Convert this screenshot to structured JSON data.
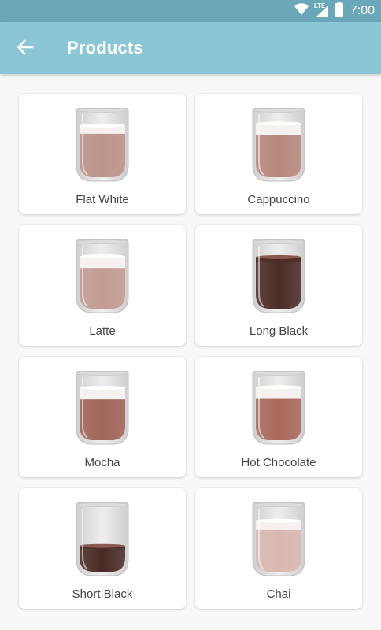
{
  "status_bar": {
    "time": "7:00",
    "network": "LTE",
    "icons": [
      "wifi-icon",
      "cell-signal-icon",
      "battery-icon"
    ]
  },
  "app_bar": {
    "title": "Products",
    "back_icon": "arrow-back-icon"
  },
  "colors": {
    "status_bar": "#6aa8b9",
    "app_bar": "#8bc6d6",
    "background": "#f8f8f8",
    "card": "#ffffff"
  },
  "products": [
    {
      "name": "Flat White",
      "fill": 0.8,
      "foam": 0.16,
      "coffee": "#bd9289"
    },
    {
      "name": "Cappuccino",
      "fill": 0.83,
      "foam": 0.22,
      "coffee": "#b8877d"
    },
    {
      "name": "Latte",
      "fill": 0.81,
      "foam": 0.22,
      "coffee": "#c39b92"
    },
    {
      "name": "Long Black",
      "fill": 0.8,
      "foam": 0.1,
      "coffee": "#4b2b26"
    },
    {
      "name": "Mocha",
      "fill": 0.81,
      "foam": 0.22,
      "coffee": "#a06458"
    },
    {
      "name": "Hot Chocolate",
      "fill": 0.82,
      "foam": 0.22,
      "coffee": "#a9685c"
    },
    {
      "name": "Short Black",
      "fill": 0.4,
      "foam": 0.1,
      "coffee": "#4a2a25"
    },
    {
      "name": "Chai",
      "fill": 0.79,
      "foam": 0.18,
      "coffee": "#dab8b0"
    }
  ]
}
